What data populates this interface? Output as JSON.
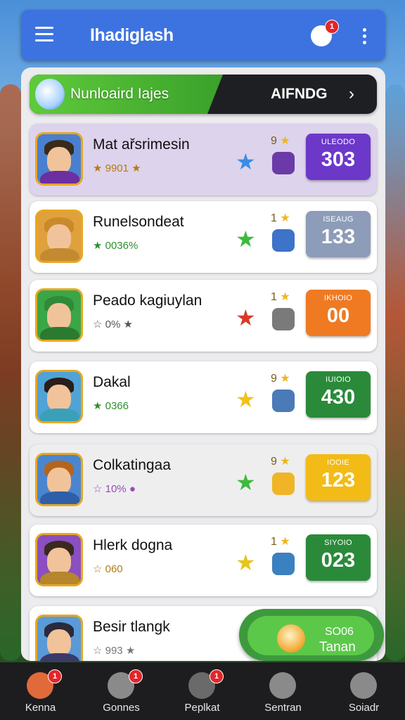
{
  "app": {
    "title": "Ihadiglash"
  },
  "header": {
    "notification_count": "1"
  },
  "banner": {
    "text": "Nunloaird Iajes",
    "action": "AIFNDG",
    "chevron": "›"
  },
  "players": [
    {
      "name": "Mat ařsrimesin",
      "sub_prefix": "★",
      "sub": "9901",
      "sub_suffix": "★",
      "sub_color": "#b57b12",
      "mini_num": "9",
      "score_label": "ULEODO",
      "score_value": "303",
      "score_color": "#6c38c9",
      "star_color": "#3a8de6",
      "item_color": "#6b3aa8",
      "avatar_hair": "#3a2a1a",
      "avatar_body": "#6b2fa0",
      "avatar_bg": "#4a7fd0",
      "highlighted": true
    },
    {
      "name": "Runelsondeat",
      "sub_prefix": "★",
      "sub": "0036%",
      "sub_suffix": "",
      "sub_color": "#2d8f2d",
      "mini_num": "1",
      "score_label": "ISEAUG",
      "score_value": "133",
      "score_color": "#8d9cb8",
      "star_color": "#3dba3d",
      "item_color": "#3d73c8",
      "avatar_hair": "#c98a2b",
      "avatar_body": "#c48a32",
      "avatar_bg": "#e0a13c",
      "highlighted": false
    },
    {
      "name": "Peado kagiuylan",
      "sub_prefix": "☆",
      "sub": "0%",
      "sub_suffix": "★",
      "sub_color": "#555555",
      "mini_num": "1",
      "score_label": "IKHOIO",
      "score_value": "00",
      "score_color": "#f07a22",
      "star_color": "#d83a2a",
      "item_color": "#7a7a7a",
      "avatar_hair": "#2f8a3a",
      "avatar_body": "#2b7a2f",
      "avatar_bg": "#3aa648",
      "highlighted": false
    },
    {
      "name": "Dakal",
      "sub_prefix": "★",
      "sub": "0366",
      "sub_suffix": "",
      "sub_color": "#2d8f2d",
      "mini_num": "9",
      "score_label": "IUIOIO",
      "score_value": "430",
      "score_color": "#2a8a3a",
      "star_color": "#f2c21c",
      "item_color": "#4a7ab8",
      "avatar_hair": "#2a1e1a",
      "avatar_body": "#3aa0b8",
      "avatar_bg": "#4fa3d6",
      "highlighted": false
    },
    {
      "name": "Colkatingaa",
      "sub_prefix": "☆",
      "sub": "10%",
      "sub_suffix": "●",
      "sub_color": "#9a4bb5",
      "mini_num": "9",
      "score_label": "IOOIE",
      "score_value": "123",
      "score_color": "#f3bb16",
      "star_color": "#3dba3d",
      "item_color": "#f0b526",
      "avatar_hair": "#b5641c",
      "avatar_body": "#2f5fa8",
      "avatar_bg": "#4a86cf",
      "highlighted": false,
      "gray": true
    },
    {
      "name": "Hlerk dogna",
      "sub_prefix": "☆",
      "sub": "060",
      "sub_suffix": "",
      "sub_color": "#b57b12",
      "mini_num": "1",
      "score_label": "SIYOIO",
      "score_value": "023",
      "score_color": "#2a8a3a",
      "star_color": "#e8c41c",
      "item_color": "#3b80c0",
      "avatar_hair": "#3a2a1e",
      "avatar_body": "#b5862b",
      "avatar_bg": "#8a4fc0",
      "highlighted": false
    },
    {
      "name": "Besir tlangk",
      "sub_prefix": "☆",
      "sub": "993",
      "sub_suffix": "★",
      "sub_color": "#777777",
      "avatar_hair": "#2a2a3a",
      "avatar_body": "#3a3a6a",
      "avatar_bg": "#5a9ad8",
      "partial": true
    }
  ],
  "cta": {
    "value": "SO06",
    "label": "Tanan"
  },
  "bottom_nav": [
    {
      "label": "Kenna",
      "badge": "1",
      "icon": "profile-avatar-icon",
      "color": "#e06a3a"
    },
    {
      "label": "Gonnes",
      "badge": "1",
      "icon": "games-icon",
      "color": "#8a8a8a"
    },
    {
      "label": "Peplkat",
      "badge": "1",
      "icon": "package-icon",
      "color": "#6a6a6a"
    },
    {
      "label": "Sentran",
      "badge": "",
      "icon": "search-icon",
      "color": "#8a8a8a"
    },
    {
      "label": "Soiadr",
      "badge": "",
      "icon": "settings-icon",
      "color": "#8a8a8a"
    }
  ]
}
